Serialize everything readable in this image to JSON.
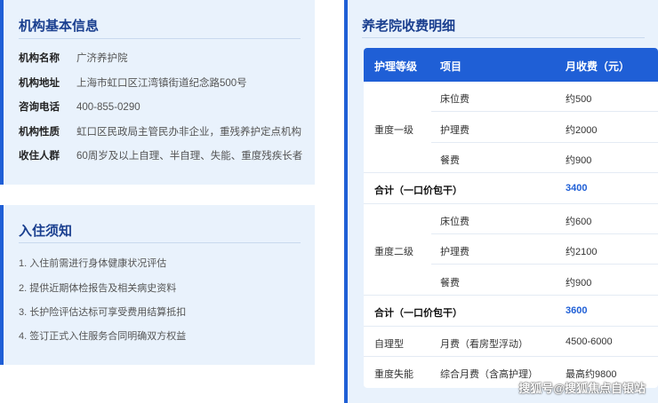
{
  "info": {
    "title": "机构基本信息",
    "rows": [
      {
        "key": "机构名称",
        "value": "广济养护院"
      },
      {
        "key": "机构地址",
        "value": "上海市虹口区江湾镇街道纪念路500号"
      },
      {
        "key": "咨询电话",
        "value": "400-855-0290"
      },
      {
        "key": "机构性质",
        "value": "虹口区民政局主管民办非企业，重残养护定点机构"
      },
      {
        "key": "收住人群",
        "value": "60周岁及以上自理、半自理、失能、重度残疾长者"
      }
    ]
  },
  "notice": {
    "title": "入住须知",
    "items": [
      "1. 入住前需进行身体健康状况评估",
      "2. 提供近期体检报告及相关病史资料",
      "3. 长护险评估达标可享受费用结算抵扣",
      "4. 签订正式入住服务合同明确双方权益"
    ]
  },
  "fees": {
    "title": "养老院收费明细",
    "headers": [
      "护理等级",
      "项目",
      "月收费（元）"
    ],
    "group1": {
      "level": "重度一级",
      "items": [
        {
          "item": "床位费",
          "fee": "约500"
        },
        {
          "item": "护理费",
          "fee": "约2000"
        },
        {
          "item": "餐费",
          "fee": "约900"
        }
      ],
      "total_label": "合计（一口价包干）",
      "total_value": "3400"
    },
    "group2": {
      "level": "重度二级",
      "items": [
        {
          "item": "床位费",
          "fee": "约600"
        },
        {
          "item": "护理费",
          "fee": "约2100"
        },
        {
          "item": "餐费",
          "fee": "约900"
        }
      ],
      "total_label": "合计（一口价包干）",
      "total_value": "3600"
    },
    "extra": [
      {
        "level": "自理型",
        "item": "月费（看房型浮动）",
        "fee": "4500-6000"
      },
      {
        "level": "重度失能",
        "item": "综合月费（含高护理）",
        "fee": "最高约9800"
      }
    ]
  },
  "watermark": "搜狐号@搜狐焦点自银站",
  "colors": {
    "accent": "#1f5fd6",
    "card_bg": "#e9f2fc",
    "title": "#1a3f8f"
  }
}
